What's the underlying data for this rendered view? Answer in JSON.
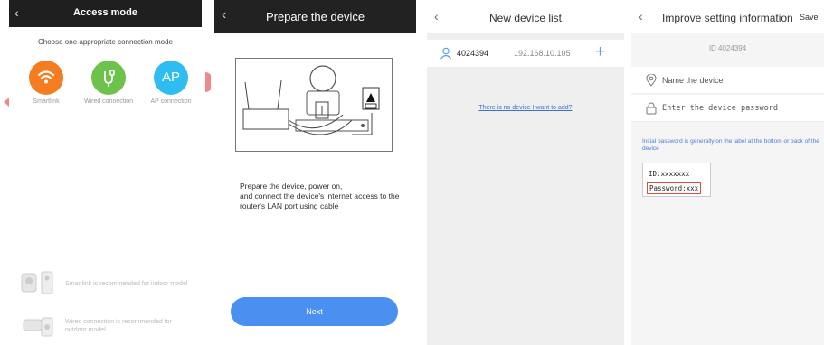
{
  "panel1": {
    "title": "Access mode",
    "subtitle": "Choose one appropriate connection mode",
    "modes": [
      {
        "label": "Smartlink",
        "color": "#f57c1f",
        "icon": "wifi-icon"
      },
      {
        "label": "Wired connection",
        "color": "#6cc24a",
        "icon": "cable-plug-icon"
      },
      {
        "label": "AP connection",
        "color": "#2ebdf0",
        "icon": "ap-text-icon",
        "icon_text": "AP"
      }
    ],
    "recommendations": [
      {
        "text": "Smartlink is recommended for indoor model",
        "icon": "indoor-camera-icon"
      },
      {
        "text": "Wired connection is recommended for outdoor model",
        "icon": "outdoor-camera-icon"
      }
    ]
  },
  "panel2": {
    "title": "Prepare the device",
    "description": "Prepare the device, power on,\n and connect the device's internet access to the router's LAN port using cable",
    "button": "Next"
  },
  "panel3": {
    "title": "New device list",
    "device": {
      "id": "4024394",
      "ip": "192.168.10.105"
    },
    "no_device_link": "There is no device I want to add?"
  },
  "panel4": {
    "title": "Improve setting information",
    "save": "Save",
    "id_label": "ID 4024394",
    "name_placeholder": "Name the device",
    "password_placeholder": "Enter the device password",
    "hint": "Initial password is generally on the label at the bottom or back of the device",
    "label_id": "ID:xxxxxxx",
    "label_password": "Password:xxx"
  }
}
